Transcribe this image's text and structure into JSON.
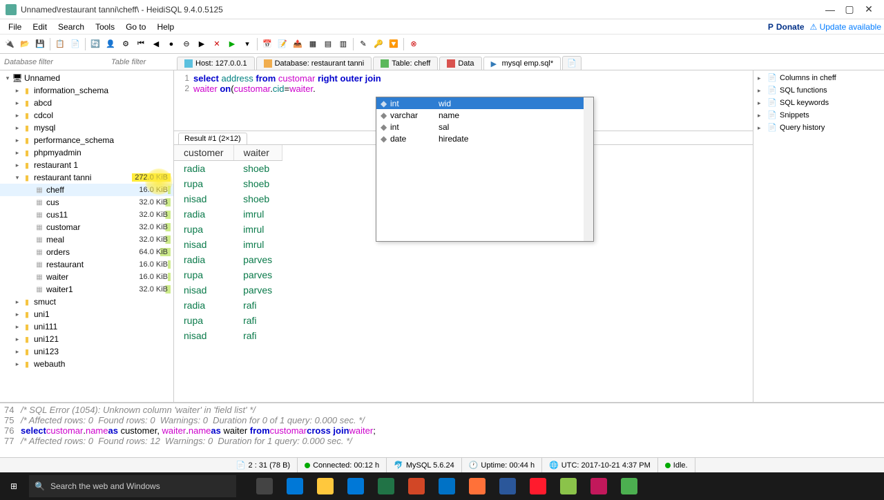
{
  "window": {
    "title": "Unnamed\\restaurant tanni\\cheff\\ - HeidiSQL 9.4.0.5125",
    "minimize": "—",
    "maximize": "▢",
    "close": "✕"
  },
  "menu": {
    "items": [
      "File",
      "Edit",
      "Search",
      "Tools",
      "Go to",
      "Help"
    ],
    "donate": "Donate",
    "update": "Update available"
  },
  "filters": {
    "db": "Database filter",
    "table": "Table filter"
  },
  "tabs": {
    "host": "Host: 127.0.0.1",
    "database": "Database: restaurant tanni",
    "table": "Table: cheff",
    "data": "Data",
    "query": "mysql emp.sql*"
  },
  "sql": {
    "line1_tokens": [
      "select",
      " ",
      "address",
      " ",
      "from",
      " ",
      "customar",
      " ",
      "right",
      " ",
      "outer",
      " ",
      "join"
    ],
    "line1_classes": [
      "kw",
      "",
      "id",
      "",
      "kw",
      "",
      "fn",
      "",
      "kw",
      "",
      "kw",
      "",
      "kw"
    ],
    "line2_tokens": [
      "waiter",
      " ",
      "on",
      "(",
      "customar",
      ".",
      "cid",
      "=",
      "waiter",
      "."
    ],
    "line2_classes": [
      "fn",
      "",
      "kw",
      "op",
      "fn",
      "op",
      "id",
      "op",
      "fn",
      "op"
    ]
  },
  "autocomplete": {
    "items": [
      {
        "type": "int",
        "name": "wid",
        "sel": true
      },
      {
        "type": "varchar",
        "name": "name",
        "sel": false
      },
      {
        "type": "int",
        "name": "sal",
        "sel": false
      },
      {
        "type": "date",
        "name": "hiredate",
        "sel": false
      }
    ]
  },
  "tree": {
    "root": "Unnamed",
    "dbs": [
      {
        "name": "information_schema"
      },
      {
        "name": "abcd"
      },
      {
        "name": "cdcol"
      },
      {
        "name": "mysql"
      },
      {
        "name": "performance_schema"
      },
      {
        "name": "phpmyadmin"
      },
      {
        "name": "restaurant 1"
      },
      {
        "name": "restaurant tanni",
        "size": "272.0 KiB",
        "expanded": true,
        "selected": false,
        "szc": "sz-272",
        "tables": [
          {
            "name": "cheff",
            "size": "16.0 KiB",
            "szc": "sz-16",
            "selected": true
          },
          {
            "name": "cus",
            "size": "32.0 KiB",
            "szc": "sz-32"
          },
          {
            "name": "cus11",
            "size": "32.0 KiB",
            "szc": "sz-32"
          },
          {
            "name": "customar",
            "size": "32.0 KiB",
            "szc": "sz-32"
          },
          {
            "name": "meal",
            "size": "32.0 KiB",
            "szc": "sz-32"
          },
          {
            "name": "orders",
            "size": "64.0 KiB",
            "szc": "sz-64"
          },
          {
            "name": "restaurant",
            "size": "16.0 KiB",
            "szc": "sz-16"
          },
          {
            "name": "waiter",
            "size": "16.0 KiB",
            "szc": "sz-16"
          },
          {
            "name": "waiter1",
            "size": "32.0 KiB",
            "szc": "sz-32"
          }
        ]
      },
      {
        "name": "smuct"
      },
      {
        "name": "uni1"
      },
      {
        "name": "uni111"
      },
      {
        "name": "uni121"
      },
      {
        "name": "uni123"
      },
      {
        "name": "webauth"
      }
    ]
  },
  "result": {
    "tab": "Result #1 (2×12)",
    "cols": [
      "customer",
      "waiter"
    ],
    "rows": [
      [
        "radia",
        "shoeb"
      ],
      [
        "rupa",
        "shoeb"
      ],
      [
        "nisad",
        "shoeb"
      ],
      [
        "radia",
        "imrul"
      ],
      [
        "rupa",
        "imrul"
      ],
      [
        "nisad",
        "imrul"
      ],
      [
        "radia",
        "parves"
      ],
      [
        "rupa",
        "parves"
      ],
      [
        "nisad",
        "parves"
      ],
      [
        "radia",
        "rafi"
      ],
      [
        "rupa",
        "rafi"
      ],
      [
        "nisad",
        "rafi"
      ]
    ]
  },
  "rightpanel": [
    "Columns in cheff",
    "SQL functions",
    "SQL keywords",
    "Snippets",
    "Query history"
  ],
  "log": {
    "lines": [
      {
        "n": "74",
        "t": "/* SQL Error (1054): Unknown column 'waiter' in 'field list' */",
        "c": "cm"
      },
      {
        "n": "75",
        "t": "/* Affected rows: 0  Found rows: 0  Warnings: 0  Duration for 0 of 1 query: 0.000 sec. */",
        "c": "cm"
      },
      {
        "n": "76",
        "html": "<span class='lkw'>select</span> <span class='lid'>customar</span>.<span class='lid'>name</span> <span class='lkw'>as</span> customer, <span class='lid'>waiter</span>.<span class='lid'>name</span> <span class='lkw'>as</span> waiter <span class='lkw'>from</span> <span class='lid'>customar</span> <span class='lkw'>cross join</span> <span class='lid'>waiter</span>;"
      },
      {
        "n": "77",
        "t": "/* Affected rows: 0  Found rows: 12  Warnings: 0  Duration for 1 query: 0.000 sec. */",
        "c": "cm"
      }
    ]
  },
  "status": {
    "pos": "2 : 31 (78 B)",
    "conn": "Connected: 00:12 h",
    "server": "MySQL 5.6.24",
    "uptime": "Uptime: 00:44 h",
    "clock": "UTC: 2017-10-21 4:37 PM",
    "idle": "Idle."
  },
  "taskbar": {
    "search": "Search the web and Windows"
  }
}
